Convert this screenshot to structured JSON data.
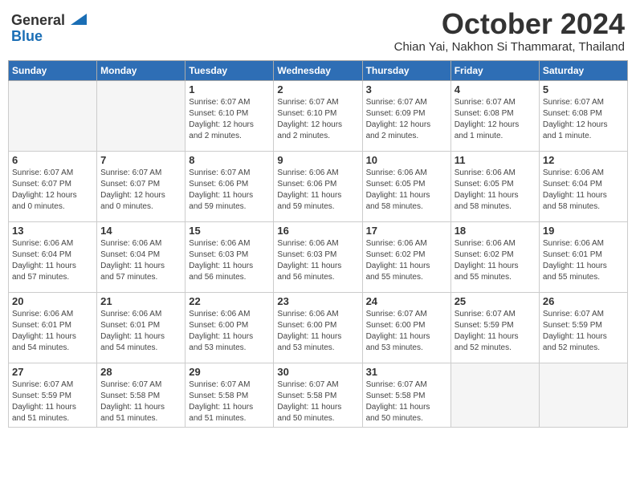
{
  "logo": {
    "general": "General",
    "blue": "Blue"
  },
  "title": "October 2024",
  "location": "Chian Yai, Nakhon Si Thammarat, Thailand",
  "weekdays": [
    "Sunday",
    "Monday",
    "Tuesday",
    "Wednesday",
    "Thursday",
    "Friday",
    "Saturday"
  ],
  "weeks": [
    [
      {
        "day": "",
        "info": ""
      },
      {
        "day": "",
        "info": ""
      },
      {
        "day": "1",
        "info": "Sunrise: 6:07 AM\nSunset: 6:10 PM\nDaylight: 12 hours\nand 2 minutes."
      },
      {
        "day": "2",
        "info": "Sunrise: 6:07 AM\nSunset: 6:10 PM\nDaylight: 12 hours\nand 2 minutes."
      },
      {
        "day": "3",
        "info": "Sunrise: 6:07 AM\nSunset: 6:09 PM\nDaylight: 12 hours\nand 2 minutes."
      },
      {
        "day": "4",
        "info": "Sunrise: 6:07 AM\nSunset: 6:08 PM\nDaylight: 12 hours\nand 1 minute."
      },
      {
        "day": "5",
        "info": "Sunrise: 6:07 AM\nSunset: 6:08 PM\nDaylight: 12 hours\nand 1 minute."
      }
    ],
    [
      {
        "day": "6",
        "info": "Sunrise: 6:07 AM\nSunset: 6:07 PM\nDaylight: 12 hours\nand 0 minutes."
      },
      {
        "day": "7",
        "info": "Sunrise: 6:07 AM\nSunset: 6:07 PM\nDaylight: 12 hours\nand 0 minutes."
      },
      {
        "day": "8",
        "info": "Sunrise: 6:07 AM\nSunset: 6:06 PM\nDaylight: 11 hours\nand 59 minutes."
      },
      {
        "day": "9",
        "info": "Sunrise: 6:06 AM\nSunset: 6:06 PM\nDaylight: 11 hours\nand 59 minutes."
      },
      {
        "day": "10",
        "info": "Sunrise: 6:06 AM\nSunset: 6:05 PM\nDaylight: 11 hours\nand 58 minutes."
      },
      {
        "day": "11",
        "info": "Sunrise: 6:06 AM\nSunset: 6:05 PM\nDaylight: 11 hours\nand 58 minutes."
      },
      {
        "day": "12",
        "info": "Sunrise: 6:06 AM\nSunset: 6:04 PM\nDaylight: 11 hours\nand 58 minutes."
      }
    ],
    [
      {
        "day": "13",
        "info": "Sunrise: 6:06 AM\nSunset: 6:04 PM\nDaylight: 11 hours\nand 57 minutes."
      },
      {
        "day": "14",
        "info": "Sunrise: 6:06 AM\nSunset: 6:04 PM\nDaylight: 11 hours\nand 57 minutes."
      },
      {
        "day": "15",
        "info": "Sunrise: 6:06 AM\nSunset: 6:03 PM\nDaylight: 11 hours\nand 56 minutes."
      },
      {
        "day": "16",
        "info": "Sunrise: 6:06 AM\nSunset: 6:03 PM\nDaylight: 11 hours\nand 56 minutes."
      },
      {
        "day": "17",
        "info": "Sunrise: 6:06 AM\nSunset: 6:02 PM\nDaylight: 11 hours\nand 55 minutes."
      },
      {
        "day": "18",
        "info": "Sunrise: 6:06 AM\nSunset: 6:02 PM\nDaylight: 11 hours\nand 55 minutes."
      },
      {
        "day": "19",
        "info": "Sunrise: 6:06 AM\nSunset: 6:01 PM\nDaylight: 11 hours\nand 55 minutes."
      }
    ],
    [
      {
        "day": "20",
        "info": "Sunrise: 6:06 AM\nSunset: 6:01 PM\nDaylight: 11 hours\nand 54 minutes."
      },
      {
        "day": "21",
        "info": "Sunrise: 6:06 AM\nSunset: 6:01 PM\nDaylight: 11 hours\nand 54 minutes."
      },
      {
        "day": "22",
        "info": "Sunrise: 6:06 AM\nSunset: 6:00 PM\nDaylight: 11 hours\nand 53 minutes."
      },
      {
        "day": "23",
        "info": "Sunrise: 6:06 AM\nSunset: 6:00 PM\nDaylight: 11 hours\nand 53 minutes."
      },
      {
        "day": "24",
        "info": "Sunrise: 6:07 AM\nSunset: 6:00 PM\nDaylight: 11 hours\nand 53 minutes."
      },
      {
        "day": "25",
        "info": "Sunrise: 6:07 AM\nSunset: 5:59 PM\nDaylight: 11 hours\nand 52 minutes."
      },
      {
        "day": "26",
        "info": "Sunrise: 6:07 AM\nSunset: 5:59 PM\nDaylight: 11 hours\nand 52 minutes."
      }
    ],
    [
      {
        "day": "27",
        "info": "Sunrise: 6:07 AM\nSunset: 5:59 PM\nDaylight: 11 hours\nand 51 minutes."
      },
      {
        "day": "28",
        "info": "Sunrise: 6:07 AM\nSunset: 5:58 PM\nDaylight: 11 hours\nand 51 minutes."
      },
      {
        "day": "29",
        "info": "Sunrise: 6:07 AM\nSunset: 5:58 PM\nDaylight: 11 hours\nand 51 minutes."
      },
      {
        "day": "30",
        "info": "Sunrise: 6:07 AM\nSunset: 5:58 PM\nDaylight: 11 hours\nand 50 minutes."
      },
      {
        "day": "31",
        "info": "Sunrise: 6:07 AM\nSunset: 5:58 PM\nDaylight: 11 hours\nand 50 minutes."
      },
      {
        "day": "",
        "info": ""
      },
      {
        "day": "",
        "info": ""
      }
    ]
  ]
}
